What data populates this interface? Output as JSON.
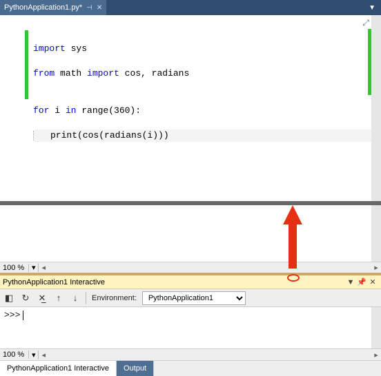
{
  "tabs": {
    "file_name": "PythonApplication1.py*"
  },
  "code": {
    "line1a": "import",
    "line1b": " sys",
    "line2a": "from",
    "line2b": " math ",
    "line2c": "import",
    "line2d": " cos, radians",
    "line3": "",
    "line4a": "for",
    "line4b": " i ",
    "line4c": "in",
    "line4d": " range(360):",
    "line5": "print(cos(radians(i)))"
  },
  "zoom": {
    "level": "100 %"
  },
  "interactive": {
    "title": "PythonApplication1 Interactive",
    "env_label": "Environment:",
    "env_value": "PythonApplication1",
    "prompt": ">>>"
  },
  "zoom2": {
    "level": "100 %"
  },
  "bottom_tabs": {
    "tab1": "PythonApplication1 Interactive",
    "tab2": "Output"
  }
}
